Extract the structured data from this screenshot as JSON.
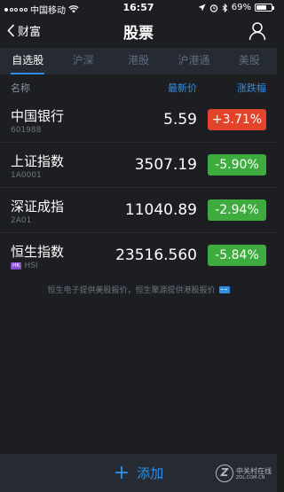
{
  "status_bar": {
    "carrier": "中国移动",
    "time": "16:57",
    "battery": "69%",
    "battery_level": 0.69,
    "icons": [
      "signal-dots-icon",
      "wifi-icon",
      "location-icon",
      "alarm-icon",
      "bluetooth-icon",
      "battery-icon"
    ]
  },
  "nav": {
    "back_label": "财富",
    "title": "股票",
    "icons": {
      "back": "chevron-left-icon",
      "user": "user-icon"
    }
  },
  "tabs": [
    {
      "label": "自选股",
      "active": true
    },
    {
      "label": "沪深",
      "active": false
    },
    {
      "label": "港股",
      "active": false
    },
    {
      "label": "沪港通",
      "active": false
    },
    {
      "label": "美股",
      "active": false
    }
  ],
  "columns": {
    "name": "名称",
    "price": "最新价",
    "change": "涨跌幅"
  },
  "stocks": [
    {
      "name": "中国银行",
      "code": "601988",
      "price": "5.59",
      "change": "+3.71%",
      "direction": "up",
      "badge": ""
    },
    {
      "name": "上证指数",
      "code": "1A0001",
      "price": "3507.19",
      "change": "-5.90%",
      "direction": "down",
      "badge": ""
    },
    {
      "name": "深证成指",
      "code": "2A01",
      "price": "11040.89",
      "change": "-2.94%",
      "direction": "down",
      "badge": ""
    },
    {
      "name": "恒生指数",
      "code": "HSI",
      "price": "23516.560",
      "change": "-5.84%",
      "direction": "down",
      "badge": "HK"
    }
  ],
  "footnote": "恒生电子提供美股报价，恒生聚源提供港股报价",
  "add_button": {
    "plus": "+",
    "label": "添加"
  },
  "watermark": {
    "logo": "Z",
    "text": "中关村在线",
    "sub": "ZOL.COM.CN"
  },
  "colors": {
    "up": "#e2432a",
    "down": "#3dab3d",
    "accent": "#2f8fe6",
    "background": "#1c1e22"
  }
}
